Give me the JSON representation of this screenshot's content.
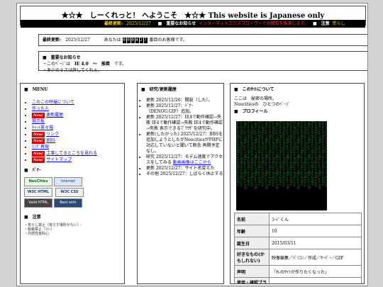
{
  "header": {
    "title": "★☆★　しーくれっと！ へようこそ　★☆★ This website is Japanese only",
    "marquee": {
      "update_label": "最終更新:",
      "update_date": "2025/12/27",
      "notice_label": "■　重要なお知らせ",
      "notice_text": "インターネットエクスプローラーでの閲覧を推奨します。",
      "warning_label": "■　注意",
      "warning_text": "荒らし"
    }
  },
  "update_box": {
    "label": "最終更新:",
    "date": "2025/12/27",
    "visitor_prefix": "あなたは",
    "counter_digits": [
      "0",
      "0",
      "0",
      "4",
      "2",
      "7"
    ],
    "visitor_suffix": "番目のお客様です。"
  },
  "notice": {
    "heading": "■　重要なお知らせ",
    "line1_a": "・このﾍﾟｰｼﾞは",
    "line1_b": "IE 4.0　〜　推奨",
    "line1_c": "です。",
    "line2": "・多少のミスは許してくれぇ。"
  },
  "menu": {
    "heading": "■　MENU",
    "items": [
      {
        "label": "このこの特撮について",
        "new": false
      },
      {
        "label": "作った人",
        "new": false
      },
      {
        "label": "更新履歴",
        "new": true
      },
      {
        "label": "掲示板",
        "new": false
      },
      {
        "label": "ﾁｬｯﾄ茶々場",
        "new": false
      },
      {
        "label": "リンク",
        "new": true
      },
      {
        "label": "BBS",
        "new": true
      },
      {
        "label": "ﾘﾝｸﾞ再現",
        "new": false
      },
      {
        "label": "工事してるところを見れる",
        "new": true
      },
      {
        "label": "サイトマップ",
        "new": true
      }
    ],
    "new_badge": "New!",
    "banner_heading": "■　ﾊﾞﾅｰ",
    "banners": [
      "NeoCities",
      "Internet Explorer",
      "W3C HTML 3.2",
      "W3C CSS",
      "Valid HTML",
      "Best with Netscape"
    ],
    "notes_heading": "■　注意",
    "notes": [
      "・荒らし禁止（荒らす場所がない）・",
      "・転載禁止（ﾏﾅｰ）",
      "・共感性羞恥心"
    ]
  },
  "news": {
    "heading": "■　研究/更新履歴",
    "items": [
      "更新 2025/12/26：開設（した）。",
      "更新 2025/12/27：ﾊﾞﾅｰ（DENOU.GIF）追加。",
      "更新 2025/12/27：IE4で動作確認→失敗 IE4で動作確認→失敗 IE4で動作確認→失敗 表示できるﾌﾞﾗｳｻﾞを研究中。",
      "更新(したかった) 2025/12/27：BBSを追加しようとしたがNeocitiesがPHPに対応していないと聞いて断念 再開予定なし。",
      "研究 2025/12/27：モデム速度でアクセスをしてみる",
      "更新 2025/12/27：サイト名変えた",
      "その他 2025/12/27：しばらく休止する"
    ],
    "link_text": "動画画像はここから"
  },
  "profile": {
    "heading": "■　このｻｲﾄについて",
    "intro1": "ここは　秘密の場所。",
    "intro2": "Neocitiesの　ひとつのﾍﾟｰｼﾞ",
    "sub": "■　プロフィール",
    "rows": [
      {
        "k": "名前",
        "v": "ｺｰﾄﾞくん"
      },
      {
        "k": "年齢",
        "v": "10"
      },
      {
        "k": "誕生日",
        "v": "2015/03/11"
      },
      {
        "k": "好きなもの(か もしれない)",
        "v": "映像編集／ﾊﾟｿｺﾝ／作成／ｻｰﾊﾞｰ／GIF"
      },
      {
        "k": "声明",
        "v": "「ｵﾚのｻｲﾄが作りたくなった」"
      },
      {
        "k": "使用・確認ブラウザ",
        "v": "Brave Edge IE4,6,8,11"
      }
    ]
  },
  "colors": {
    "marquee_bg": "#000000",
    "marquee_text": "#ffd400",
    "new_badge": "#dd0000",
    "link": "#0000ee",
    "matrix": "#21c23a"
  }
}
